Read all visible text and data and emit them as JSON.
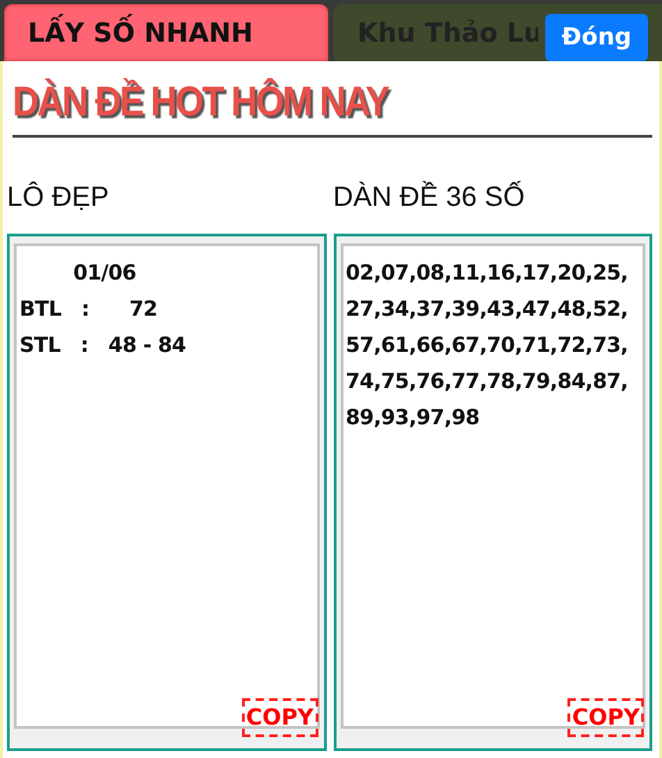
{
  "tabs": [
    {
      "label": "LẤY SỐ NHANH",
      "selected": true
    },
    {
      "label": "Khu Thảo Lu",
      "selected": false
    }
  ],
  "close_button": "Đóng",
  "title": "DÀN ĐỀ HOT HÔM NAY",
  "panels": [
    {
      "heading": "LÔ ĐẸP",
      "value": "        01/06\nBTL   :      72\nSTL   :   48 - 84",
      "copy_button": "COPY"
    },
    {
      "heading": "DÀN ĐỀ 36 SỐ",
      "value": "02,07,08,11,16,17,20,25,27,34,37,39,43,47,48,52,57,61,66,67,70,71,72,73,74,75,76,77,78,79,84,87,89,93,97,98",
      "copy_button": "COPY"
    }
  ]
}
